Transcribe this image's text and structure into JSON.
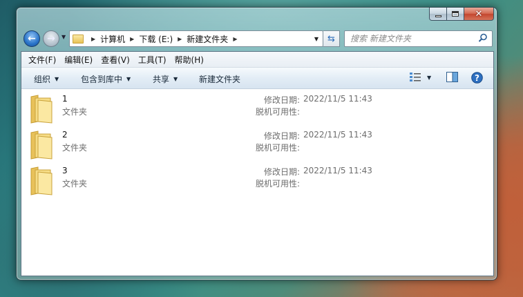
{
  "address": {
    "breadcrumbs": [
      "计算机",
      "下载 (E:)",
      "新建文件夹"
    ]
  },
  "search": {
    "placeholder": "搜索 新建文件夹"
  },
  "menu": [
    "文件(F)",
    "编辑(E)",
    "查看(V)",
    "工具(T)",
    "帮助(H)"
  ],
  "toolbar": {
    "organize": "组织",
    "include_in_library": "包含到库中",
    "share": "共享",
    "new_folder": "新建文件夹"
  },
  "files": [
    {
      "name": "1",
      "type": "文件夹",
      "modified_label": "修改日期:",
      "modified": "2022/11/5 11:43",
      "offline_label": "脱机可用性:"
    },
    {
      "name": "2",
      "type": "文件夹",
      "modified_label": "修改日期:",
      "modified": "2022/11/5 11:43",
      "offline_label": "脱机可用性:"
    },
    {
      "name": "3",
      "type": "文件夹",
      "modified_label": "修改日期:",
      "modified": "2022/11/5 11:43",
      "offline_label": "脱机可用性:"
    }
  ],
  "icons": {
    "back": "back-arrow-icon",
    "forward": "forward-arrow-icon",
    "refresh": "refresh-icon",
    "search": "search-icon",
    "view": "view-options-icon",
    "preview": "preview-pane-icon",
    "help": "help-icon",
    "folder": "folder-icon"
  },
  "colors": {
    "accent": "#2a74c9",
    "close_button": "#c3462e",
    "secondary_text": "#6d6d6d"
  }
}
